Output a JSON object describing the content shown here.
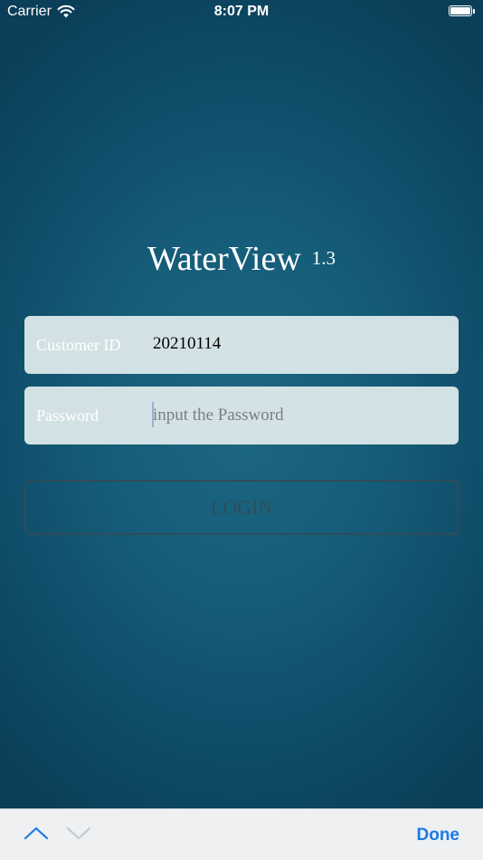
{
  "status_bar": {
    "carrier": "Carrier",
    "time": "8:07 PM",
    "icons": [
      "wifi-icon",
      "battery-icon"
    ]
  },
  "app": {
    "name": "WaterView",
    "version": "1.3"
  },
  "form": {
    "customer_id": {
      "label": "Customer ID",
      "value": "20210114"
    },
    "password": {
      "label": "Password",
      "value": "",
      "placeholder": "input the Password"
    },
    "login_label": "LOGIN"
  },
  "keyboard_toolbar": {
    "prev_icon": "chevron-up-icon",
    "next_icon": "chevron-down-icon",
    "done_label": "Done"
  },
  "colors": {
    "background": "#155c78",
    "field_background": "#e1eced",
    "accent": "#1a7ae6",
    "login_border": "#2f4c5a"
  }
}
